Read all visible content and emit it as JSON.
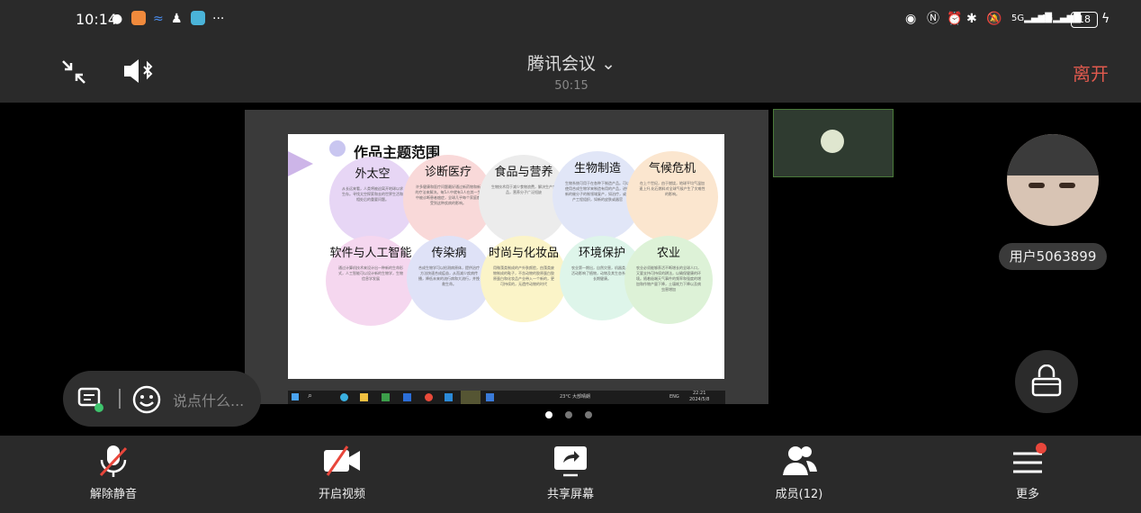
{
  "status_bar": {
    "time": "10:14",
    "battery": "18",
    "signal_5g": "5G",
    "signal_4g": "4G"
  },
  "header": {
    "title": "腾讯会议",
    "duration": "50:15",
    "leave_label": "离开"
  },
  "shared_screen": {
    "slide_title": "作品主题范围",
    "topics": [
      {
        "title": "外太空",
        "text": "从长远来看，人类将被迫离开地球以求生存。寻找太空探索和去的世界生活和相处后的重要问题。",
        "color": "#e7d6f5"
      },
      {
        "title": "诊断医疗",
        "text": "许多健康和医疗问题最好通过新药物和新的疗法来解决。每5人中就有1人在其一生中被诊断患者癌症，全球几乎每个家庭都受到这种疾病的影响。",
        "color": "#f9d9d9"
      },
      {
        "title": "食品与营养",
        "text": "生物技术用于减少食物浪费，解决生产食品，营养分子广泛短缺",
        "color": "#ececec"
      },
      {
        "title": "生物制造",
        "text": "生物系统可用于在各种下制造产品。可以使用合成生物学来制造有用的产品，进行新的催分子的制领域复产，如治疗，或生产工程组织，如新的皮肤或器官",
        "color": "#e1e6f7"
      },
      {
        "title": "气候危机",
        "text": "在上个世纪，由于燃烧，地球平均气温加速上升,化石燃料对全球气候产生了灾难性的影响。",
        "color": "#fbe6cf"
      },
      {
        "title": "软件与人工智能",
        "text": "通过计算机技术来设计出一种新的生命形式，人工智能可以设计新的生物学，生物信息学发展",
        "color": "#f5d7ef"
      },
      {
        "title": "传染病",
        "text": "合成生物学可以检测病原体，提供治疗方法快速合成疫苗，从而减少疾病传播，降低未来的流行病和大流行，并挽救生命。",
        "color": "#dfe2f7"
      },
      {
        "title": "时尚与化妆品",
        "text": "用微藻类制成的产外肤颜脸，由藻类废物制成的鞋子，不含动物的胶原蛋白胶原蛋白和化妆品产业带入一个新的，更可持续的，无遗传动物的时代",
        "color": "#fbf4c8"
      },
      {
        "title": "环境保护",
        "text": "农业第一期出，自然灾害，机器类人类活动影响了植物，动物及其生态系统的长期健康。",
        "color": "#def5ea"
      },
      {
        "title": "农业",
        "text": "农业必须能够养活不断增长的全球人口，又要支持可持续的耕法，以确保健康的环境。随着极端天气事件的频率和强度的增加和作物产量下降，土壤耗力下降以及病虫害增加",
        "color": "#ddf2d7"
      }
    ],
    "taskbar_weather": "23°C 大部晴朗",
    "taskbar_time": "22:21",
    "taskbar_date": "2024/5/8",
    "taskbar_lang": "ENG"
  },
  "participant": {
    "name": "用户5063899"
  },
  "chat": {
    "placeholder": "说点什么..."
  },
  "toolbar": {
    "mute_label": "解除静音",
    "video_label": "开启视频",
    "share_label": "共享屏幕",
    "members_label": "成员(12)",
    "more_label": "更多"
  },
  "colors": {
    "leave": "#e05a4e",
    "badge": "#e8463b",
    "mic_off": "#e8463b"
  }
}
